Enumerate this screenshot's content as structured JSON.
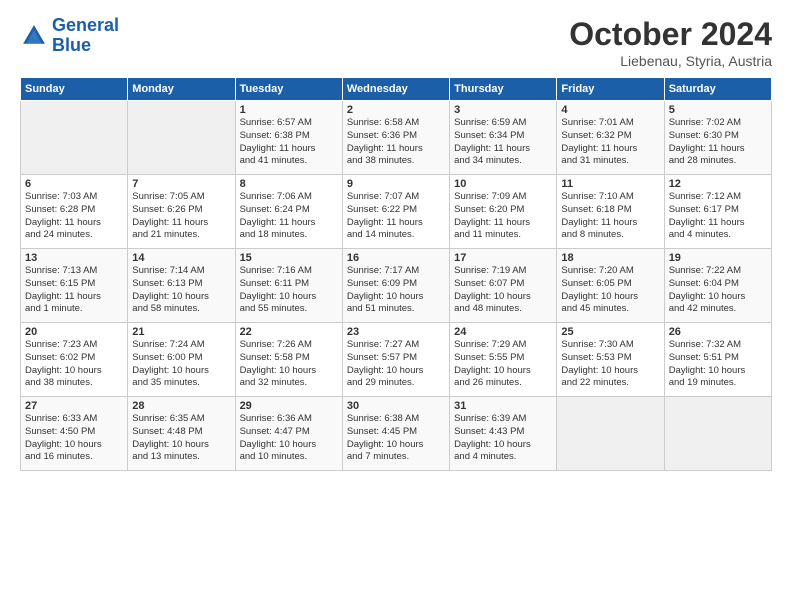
{
  "header": {
    "logo_line1": "General",
    "logo_line2": "Blue",
    "month": "October 2024",
    "location": "Liebenau, Styria, Austria"
  },
  "weekdays": [
    "Sunday",
    "Monday",
    "Tuesday",
    "Wednesday",
    "Thursday",
    "Friday",
    "Saturday"
  ],
  "rows": [
    [
      {
        "day": "",
        "info": ""
      },
      {
        "day": "",
        "info": ""
      },
      {
        "day": "1",
        "info": "Sunrise: 6:57 AM\nSunset: 6:38 PM\nDaylight: 11 hours\nand 41 minutes."
      },
      {
        "day": "2",
        "info": "Sunrise: 6:58 AM\nSunset: 6:36 PM\nDaylight: 11 hours\nand 38 minutes."
      },
      {
        "day": "3",
        "info": "Sunrise: 6:59 AM\nSunset: 6:34 PM\nDaylight: 11 hours\nand 34 minutes."
      },
      {
        "day": "4",
        "info": "Sunrise: 7:01 AM\nSunset: 6:32 PM\nDaylight: 11 hours\nand 31 minutes."
      },
      {
        "day": "5",
        "info": "Sunrise: 7:02 AM\nSunset: 6:30 PM\nDaylight: 11 hours\nand 28 minutes."
      }
    ],
    [
      {
        "day": "6",
        "info": "Sunrise: 7:03 AM\nSunset: 6:28 PM\nDaylight: 11 hours\nand 24 minutes."
      },
      {
        "day": "7",
        "info": "Sunrise: 7:05 AM\nSunset: 6:26 PM\nDaylight: 11 hours\nand 21 minutes."
      },
      {
        "day": "8",
        "info": "Sunrise: 7:06 AM\nSunset: 6:24 PM\nDaylight: 11 hours\nand 18 minutes."
      },
      {
        "day": "9",
        "info": "Sunrise: 7:07 AM\nSunset: 6:22 PM\nDaylight: 11 hours\nand 14 minutes."
      },
      {
        "day": "10",
        "info": "Sunrise: 7:09 AM\nSunset: 6:20 PM\nDaylight: 11 hours\nand 11 minutes."
      },
      {
        "day": "11",
        "info": "Sunrise: 7:10 AM\nSunset: 6:18 PM\nDaylight: 11 hours\nand 8 minutes."
      },
      {
        "day": "12",
        "info": "Sunrise: 7:12 AM\nSunset: 6:17 PM\nDaylight: 11 hours\nand 4 minutes."
      }
    ],
    [
      {
        "day": "13",
        "info": "Sunrise: 7:13 AM\nSunset: 6:15 PM\nDaylight: 11 hours\nand 1 minute."
      },
      {
        "day": "14",
        "info": "Sunrise: 7:14 AM\nSunset: 6:13 PM\nDaylight: 10 hours\nand 58 minutes."
      },
      {
        "day": "15",
        "info": "Sunrise: 7:16 AM\nSunset: 6:11 PM\nDaylight: 10 hours\nand 55 minutes."
      },
      {
        "day": "16",
        "info": "Sunrise: 7:17 AM\nSunset: 6:09 PM\nDaylight: 10 hours\nand 51 minutes."
      },
      {
        "day": "17",
        "info": "Sunrise: 7:19 AM\nSunset: 6:07 PM\nDaylight: 10 hours\nand 48 minutes."
      },
      {
        "day": "18",
        "info": "Sunrise: 7:20 AM\nSunset: 6:05 PM\nDaylight: 10 hours\nand 45 minutes."
      },
      {
        "day": "19",
        "info": "Sunrise: 7:22 AM\nSunset: 6:04 PM\nDaylight: 10 hours\nand 42 minutes."
      }
    ],
    [
      {
        "day": "20",
        "info": "Sunrise: 7:23 AM\nSunset: 6:02 PM\nDaylight: 10 hours\nand 38 minutes."
      },
      {
        "day": "21",
        "info": "Sunrise: 7:24 AM\nSunset: 6:00 PM\nDaylight: 10 hours\nand 35 minutes."
      },
      {
        "day": "22",
        "info": "Sunrise: 7:26 AM\nSunset: 5:58 PM\nDaylight: 10 hours\nand 32 minutes."
      },
      {
        "day": "23",
        "info": "Sunrise: 7:27 AM\nSunset: 5:57 PM\nDaylight: 10 hours\nand 29 minutes."
      },
      {
        "day": "24",
        "info": "Sunrise: 7:29 AM\nSunset: 5:55 PM\nDaylight: 10 hours\nand 26 minutes."
      },
      {
        "day": "25",
        "info": "Sunrise: 7:30 AM\nSunset: 5:53 PM\nDaylight: 10 hours\nand 22 minutes."
      },
      {
        "day": "26",
        "info": "Sunrise: 7:32 AM\nSunset: 5:51 PM\nDaylight: 10 hours\nand 19 minutes."
      }
    ],
    [
      {
        "day": "27",
        "info": "Sunrise: 6:33 AM\nSunset: 4:50 PM\nDaylight: 10 hours\nand 16 minutes."
      },
      {
        "day": "28",
        "info": "Sunrise: 6:35 AM\nSunset: 4:48 PM\nDaylight: 10 hours\nand 13 minutes."
      },
      {
        "day": "29",
        "info": "Sunrise: 6:36 AM\nSunset: 4:47 PM\nDaylight: 10 hours\nand 10 minutes."
      },
      {
        "day": "30",
        "info": "Sunrise: 6:38 AM\nSunset: 4:45 PM\nDaylight: 10 hours\nand 7 minutes."
      },
      {
        "day": "31",
        "info": "Sunrise: 6:39 AM\nSunset: 4:43 PM\nDaylight: 10 hours\nand 4 minutes."
      },
      {
        "day": "",
        "info": ""
      },
      {
        "day": "",
        "info": ""
      }
    ]
  ]
}
